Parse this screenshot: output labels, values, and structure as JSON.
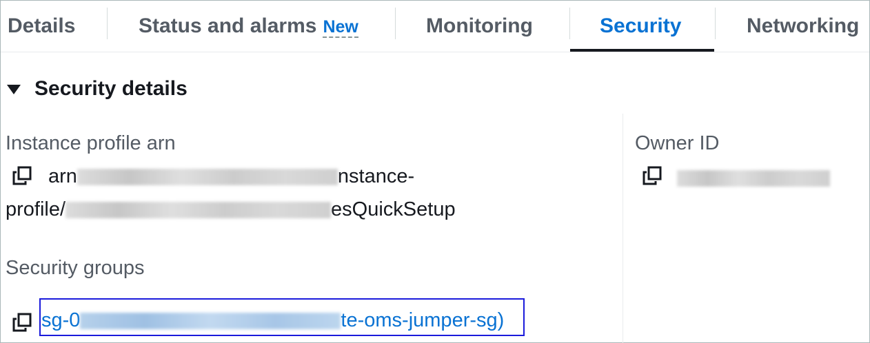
{
  "tabs": [
    {
      "label": "Details"
    },
    {
      "label": "Status and alarms",
      "badge": "New"
    },
    {
      "label": "Monitoring"
    },
    {
      "label": "Security",
      "active": true
    },
    {
      "label": "Networking"
    }
  ],
  "section": {
    "title": "Security details"
  },
  "fields": {
    "instance_profile_arn": {
      "label": "Instance profile arn",
      "line1_start": "arn",
      "line1_end": "nstance-",
      "line2_start": "profile/",
      "line2_end": "esQuickSetup"
    },
    "owner_id": {
      "label": "Owner ID"
    },
    "security_groups": {
      "label": "Security groups",
      "link_start": "sg-0",
      "link_mid": "te-oms-jumper-sg)"
    }
  },
  "icons": {
    "copy": "copy-icon",
    "caret": "caret-down-icon"
  },
  "colors": {
    "accent": "#0972d3",
    "text": "#16191f",
    "muted": "#545b64",
    "highlight_box": "#1a1adb"
  }
}
